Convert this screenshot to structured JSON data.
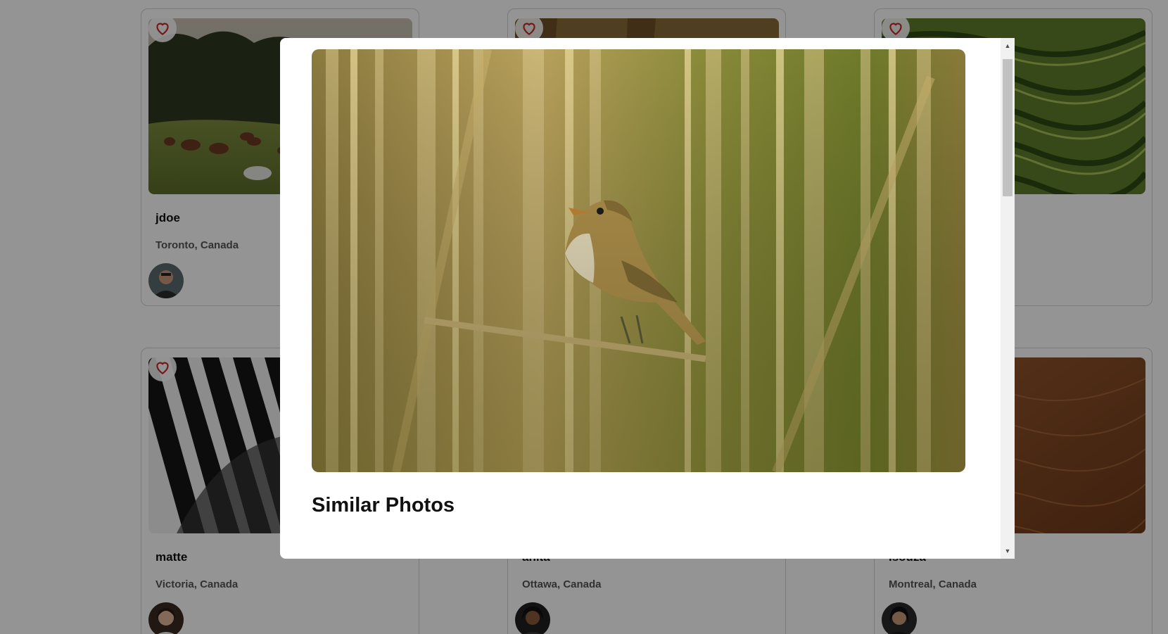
{
  "cards": [
    {
      "user": "jdoe",
      "location": "Toronto, Canada"
    },
    {
      "user": "",
      "location": ""
    },
    {
      "user": "",
      "location": ""
    },
    {
      "user": "matte",
      "location": "Victoria, Canada"
    },
    {
      "user": "anita",
      "location": "Ottawa, Canada"
    },
    {
      "user": "isouza",
      "location": "Montreal, Canada"
    }
  ],
  "modal": {
    "heading": "Similar Photos"
  },
  "icons": {
    "favorite": "heart-outline-icon",
    "scroll_up": "triangle-up-icon",
    "scroll_down": "triangle-down-icon"
  },
  "colors": {
    "heart": "#c62828",
    "overlay": "rgba(0,0,0,0.42)"
  }
}
